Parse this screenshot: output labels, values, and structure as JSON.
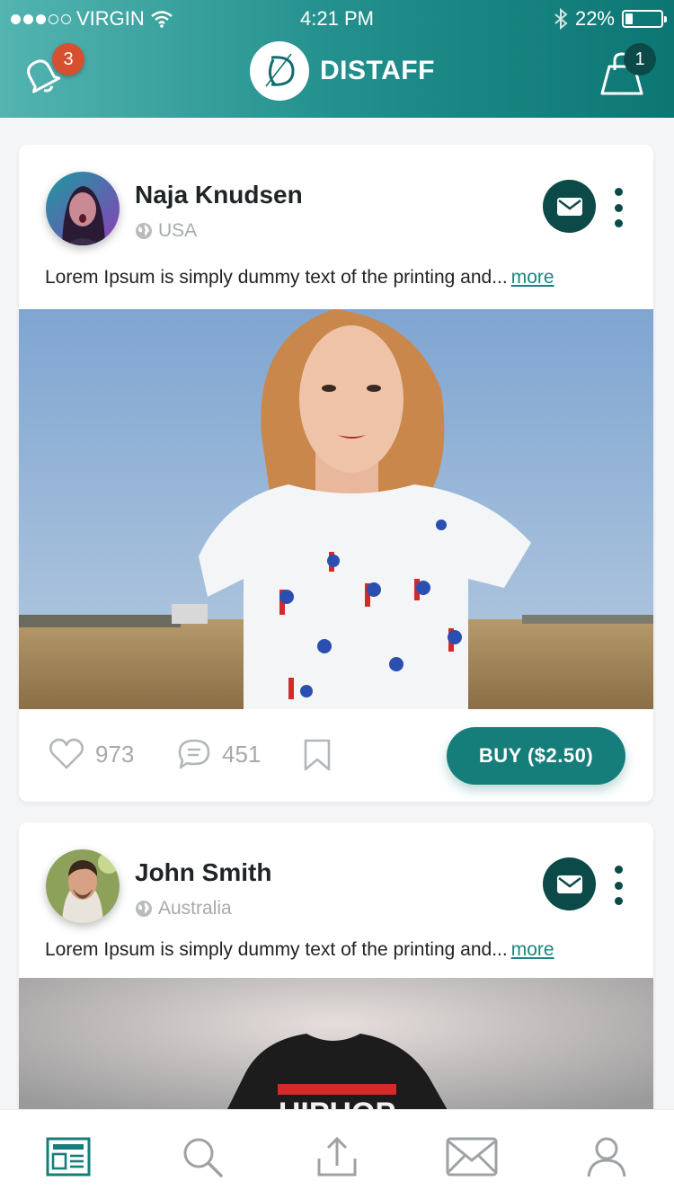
{
  "status_bar": {
    "carrier": "VIRGIN",
    "time": "4:21 PM",
    "battery": "22%",
    "battery_level": 0.22,
    "signal_bars": 3,
    "signal_total": 5
  },
  "header": {
    "app_name": "DISTAFF",
    "notification_count": "3",
    "cart_count": "1",
    "colors": {
      "accent": "#167e7a",
      "dark": "#0b4a48",
      "badge": "#d4502f"
    }
  },
  "posts": [
    {
      "author": "Naja Knudsen",
      "location": "USA",
      "text": "Lorem Ipsum is simply dummy text of the printing and...",
      "more": "more",
      "likes": "973",
      "comments": "451",
      "buy_label": "BUY ($2.50)"
    },
    {
      "author": "John Smith",
      "location": "Australia",
      "text": "Lorem Ipsum is simply dummy text of the printing and...",
      "more": "more",
      "shirt_text": "HIPHOP"
    }
  ],
  "tabbar": {
    "items": [
      {
        "name": "feed",
        "icon": "newspaper-icon",
        "active": true
      },
      {
        "name": "search",
        "icon": "search-icon",
        "active": false
      },
      {
        "name": "upload",
        "icon": "upload-icon",
        "active": false
      },
      {
        "name": "messages",
        "icon": "envelope-icon",
        "active": false
      },
      {
        "name": "profile",
        "icon": "user-icon",
        "active": false
      }
    ]
  }
}
